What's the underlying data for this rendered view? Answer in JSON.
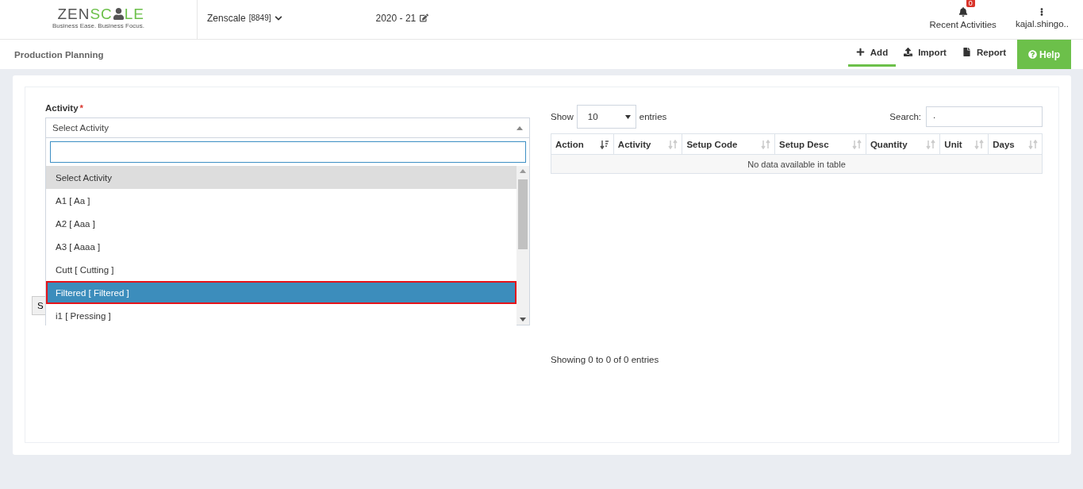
{
  "header": {
    "logo": {
      "dark": "ZEN",
      "green": "SC",
      "tail": "LE",
      "tagline": "Business Ease. Business Focus."
    },
    "company": {
      "name": "Zenscale",
      "code": "[8849]"
    },
    "year": "2020 - 21",
    "notifications": {
      "count": "0",
      "label": "Recent Activities"
    },
    "user": "kajal.shingo.."
  },
  "subheader": {
    "title": "Production Planning",
    "tabs": [
      {
        "label": "Add",
        "selected": true
      },
      {
        "label": "Import",
        "selected": false
      },
      {
        "label": "Report",
        "selected": false
      }
    ],
    "help": "Help"
  },
  "form": {
    "label": "Activity",
    "required_mark": "*",
    "select_value": "Select Activity",
    "hidden_button": "S",
    "dropdown": {
      "options": [
        {
          "label": "Select Activity",
          "selected": true,
          "highlighted": false
        },
        {
          "label": "A1 [ Aa ]",
          "selected": false,
          "highlighted": false
        },
        {
          "label": "A2 [ Aaa ]",
          "selected": false,
          "highlighted": false
        },
        {
          "label": "A3 [ Aaaa ]",
          "selected": false,
          "highlighted": false
        },
        {
          "label": "Cutt [ Cutting ]",
          "selected": false,
          "highlighted": false
        },
        {
          "label": "Filtered [ Filtered ]",
          "selected": false,
          "highlighted": true
        },
        {
          "label": "i1 [ Pressing ]",
          "selected": false,
          "highlighted": false
        }
      ]
    }
  },
  "table": {
    "show_label": "Show",
    "page_size": "10",
    "entries_label": "entries",
    "search_label": "Search:",
    "search_value": ".",
    "columns": [
      {
        "label": "Action",
        "sorted": true
      },
      {
        "label": "Activity",
        "sorted": false
      },
      {
        "label": "Setup Code",
        "sorted": false
      },
      {
        "label": "Setup Desc",
        "sorted": false
      },
      {
        "label": "Quantity",
        "sorted": false
      },
      {
        "label": "Unit",
        "sorted": false
      },
      {
        "label": "Days",
        "sorted": false
      }
    ],
    "empty": "No data available in table",
    "info": "Showing 0 to 0 of 0 entries"
  }
}
